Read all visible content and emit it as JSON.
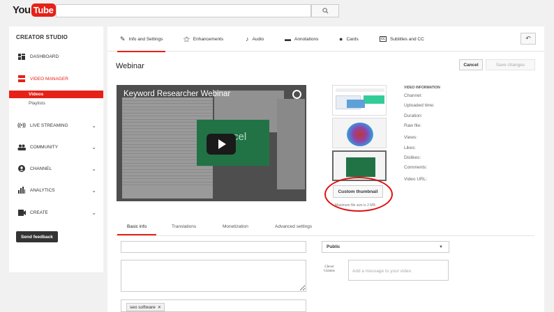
{
  "header": {
    "logo_you": "You",
    "logo_tube": "Tube",
    "search_placeholder": ""
  },
  "sidebar": {
    "title": "CREATOR STUDIO",
    "items": [
      {
        "label": "DASHBOARD",
        "icon": "dashboard-icon"
      },
      {
        "label": "VIDEO MANAGER",
        "icon": "video-manager-icon"
      },
      {
        "label": "LIVE STREAMING",
        "icon": "live-streaming-icon"
      },
      {
        "label": "COMMUNITY",
        "icon": "community-icon"
      },
      {
        "label": "CHANNEL",
        "icon": "channel-icon"
      },
      {
        "label": "ANALYTICS",
        "icon": "analytics-icon"
      },
      {
        "label": "CREATE",
        "icon": "create-icon"
      }
    ],
    "sub_items": {
      "videos": "Videos",
      "playlists": "Playlists"
    },
    "feedback": "Send feedback"
  },
  "tabs": [
    {
      "label": "Info and Settings",
      "icon": "pencil-icon"
    },
    {
      "label": "Enhancements",
      "icon": "magic-wand-icon"
    },
    {
      "label": "Audio",
      "icon": "music-note-icon"
    },
    {
      "label": "Annotations",
      "icon": "annotation-icon"
    },
    {
      "label": "Cards",
      "icon": "info-icon"
    },
    {
      "label": "Subtitles and CC",
      "icon": "cc-icon"
    }
  ],
  "video": {
    "title": "Webinar",
    "player_title": "Keyword Researcher Webinar",
    "excel_word": "cel"
  },
  "actions": {
    "cancel": "Cancel",
    "save": "Save changes"
  },
  "thumbnails": {
    "custom_button": "Custom thumbnail",
    "max_size": "Maximum file size is 2 MB."
  },
  "video_info": {
    "header": "VIDEO INFORMATION",
    "fields": [
      "Channel:",
      "Uploaded time:",
      "Duration:",
      "Raw file:",
      "Views:",
      "Likes:",
      "Dislikes:",
      "Comments:",
      "Video URL:"
    ]
  },
  "lower_tabs": [
    "Basic info",
    "Translations",
    "Monetization",
    "Advanced settings"
  ],
  "form": {
    "privacy": "Public",
    "message_placeholder": "Add a message to your video",
    "tag": "seo software",
    "avatar_text": "Clever Gizmos"
  },
  "colors": {
    "accent": "#e62117",
    "annotation_circle": "#e01010"
  }
}
